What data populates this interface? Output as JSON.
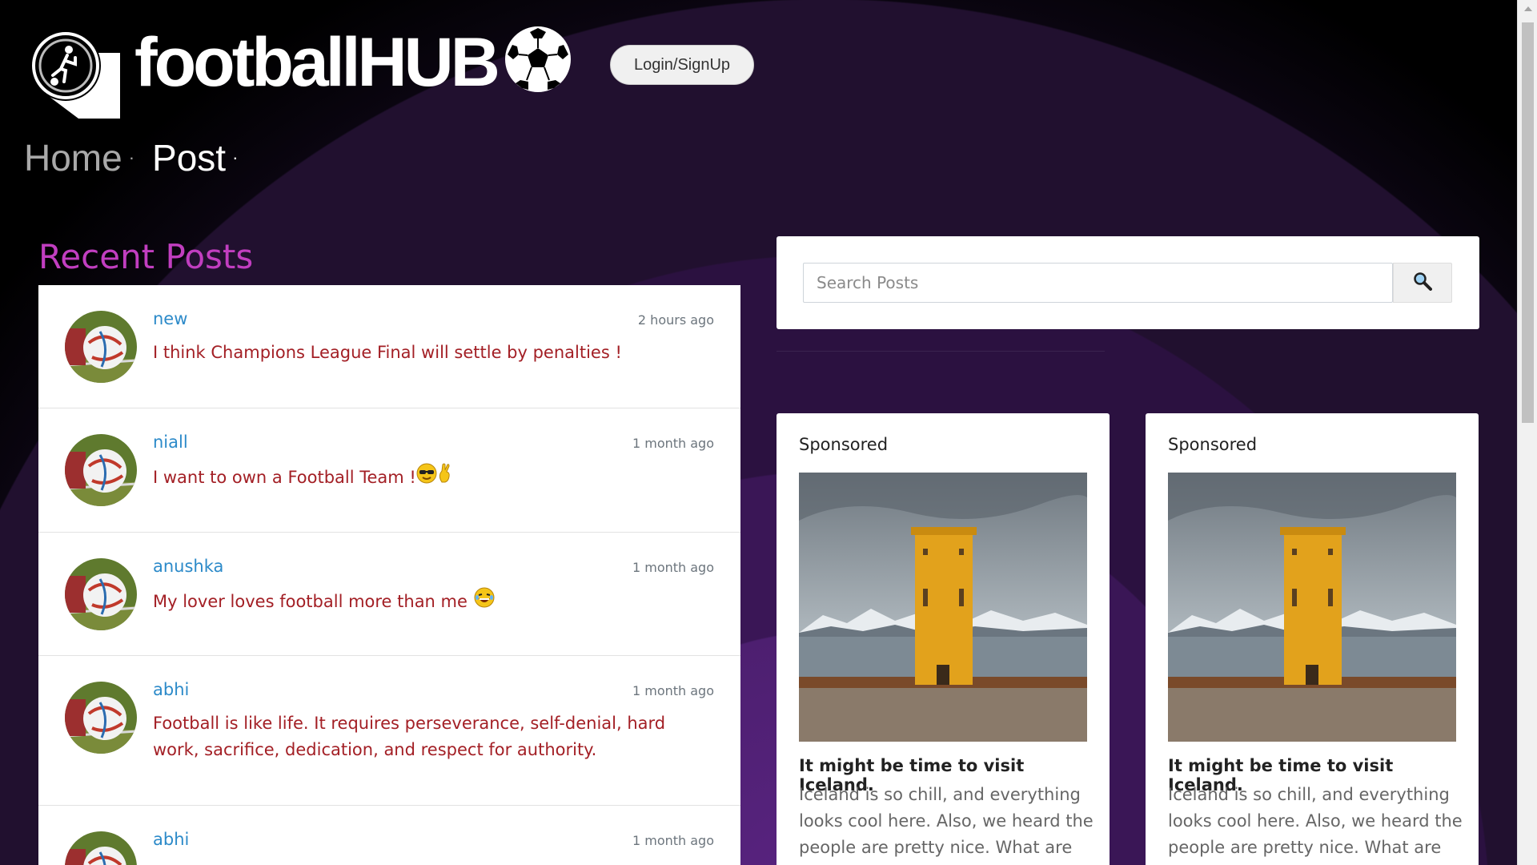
{
  "header": {
    "brand": "footballHUB",
    "login_label": "Login/SignUp"
  },
  "nav": {
    "home": "Home",
    "post": "Post",
    "separator": "·"
  },
  "recent": {
    "title": "Recent Posts",
    "posts": [
      {
        "user": "new",
        "time": "2 hours ago",
        "text": "I think Champions League Final will settle by penalties !"
      },
      {
        "user": "niall",
        "time": "1 month ago",
        "text": "I want to own a Football Team !"
      },
      {
        "user": "anushka",
        "time": "1 month ago",
        "text": "My lover loves football more than me"
      },
      {
        "user": "abhi",
        "time": "1 month ago",
        "text": "Football is like life. It requires perseverance, self-denial, hard work, sacrifice, dedication, and respect for authority."
      },
      {
        "user": "abhi",
        "time": "1 month ago",
        "text": ""
      }
    ]
  },
  "search": {
    "placeholder": "Search Posts"
  },
  "ads": [
    {
      "label": "Sponsored",
      "title": "It might be time to visit Iceland.",
      "body": "Iceland is so chill, and everything looks cool here. Also, we heard the people are pretty nice. What are you"
    },
    {
      "label": "Sponsored",
      "title": "It might be time to visit Iceland.",
      "body": "Iceland is so chill, and everything looks cool here. Also, we heard the people are pretty nice. What are you"
    }
  ],
  "icons": {
    "logo": "player-kicking-logo-icon",
    "ball": "soccer-ball-icon",
    "search": "magnifier-icon",
    "avatar": "football-avatar-icon"
  },
  "colors": {
    "accent_title": "#c13ec0",
    "username": "#2c8ac9",
    "post_text": "#a31f25",
    "background": "#2b1140"
  }
}
